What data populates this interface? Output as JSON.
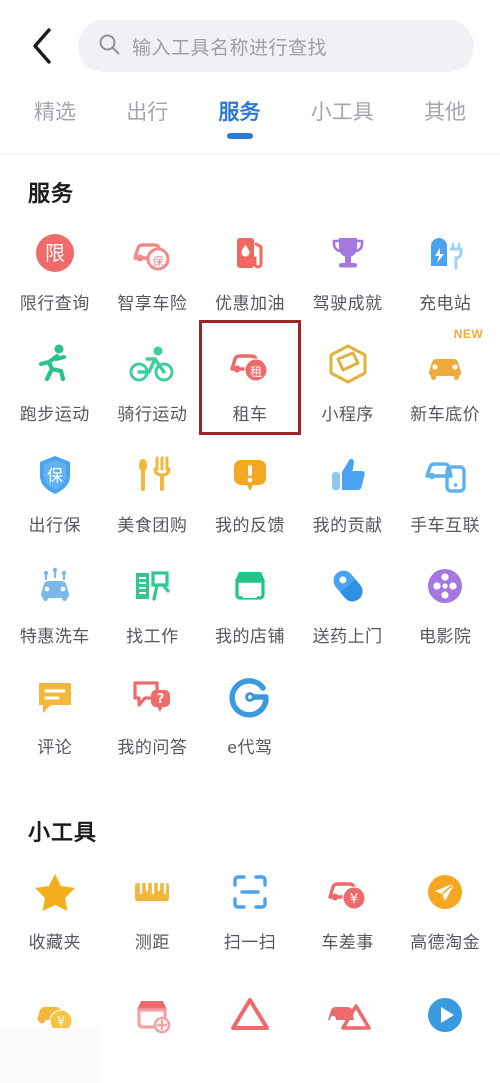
{
  "header": {
    "back_icon": "chevron-left-icon",
    "search": {
      "icon": "search-icon",
      "placeholder": "输入工具名称进行查找",
      "value": ""
    }
  },
  "tabs": {
    "active_index": 2,
    "items": [
      {
        "label": "精选"
      },
      {
        "label": "出行"
      },
      {
        "label": "服务"
      },
      {
        "label": "小工具"
      },
      {
        "label": "其他"
      }
    ]
  },
  "colors": {
    "accent": "#2f7ad4",
    "highlight_box": "#9c2528",
    "label": "#55585e",
    "tab_inactive": "#a2a6ad",
    "search_bg": "#eff1f4"
  },
  "sections": [
    {
      "title": "服务",
      "items": [
        {
          "label": "限行查询",
          "icon": "restriction-query-icon",
          "color": "#ef6b6b"
        },
        {
          "label": "智享车险",
          "icon": "car-insurance-icon",
          "color": "#f08b8b"
        },
        {
          "label": "优惠加油",
          "icon": "fuel-discount-icon",
          "color": "#f2675f"
        },
        {
          "label": "驾驶成就",
          "icon": "trophy-icon",
          "color": "#a577e0"
        },
        {
          "label": "充电站",
          "icon": "charging-station-icon",
          "color": "#4aa3f0"
        },
        {
          "label": "跑步运动",
          "icon": "running-icon",
          "color": "#29c28a"
        },
        {
          "label": "骑行运动",
          "icon": "cycling-icon",
          "color": "#3fcf9a"
        },
        {
          "label": "租车",
          "icon": "car-rental-icon",
          "color": "#ef6b6b",
          "highlighted": true
        },
        {
          "label": "小程序",
          "icon": "mini-program-icon",
          "color": "#e0b23c"
        },
        {
          "label": "新车底价",
          "icon": "new-car-price-icon",
          "color": "#f2a93b",
          "badge": "NEW"
        },
        {
          "label": "出行保",
          "icon": "travel-insurance-icon",
          "color": "#4aa3f0"
        },
        {
          "label": "美食团购",
          "icon": "food-groupon-icon",
          "color": "#f2b73b"
        },
        {
          "label": "我的反馈",
          "icon": "feedback-icon",
          "color": "#f5a623"
        },
        {
          "label": "我的贡献",
          "icon": "thumbs-up-icon",
          "color": "#4aa3f0"
        },
        {
          "label": "手车互联",
          "icon": "phone-car-link-icon",
          "color": "#5fb0ef"
        },
        {
          "label": "特惠洗车",
          "icon": "car-wash-icon",
          "color": "#7ab8e8"
        },
        {
          "label": "找工作",
          "icon": "job-search-icon",
          "color": "#2fc98d"
        },
        {
          "label": "我的店铺",
          "icon": "my-shop-icon",
          "color": "#22c48a"
        },
        {
          "label": "送药上门",
          "icon": "medicine-delivery-icon",
          "color": "#4aa3f0"
        },
        {
          "label": "电影院",
          "icon": "cinema-icon",
          "color": "#a577e0"
        },
        {
          "label": "评论",
          "icon": "comment-icon",
          "color": "#f2b73b"
        },
        {
          "label": "我的问答",
          "icon": "qa-icon",
          "color": "#ef6b6b"
        },
        {
          "label": "e代驾",
          "icon": "edaijia-icon",
          "color": "#3a9ae0"
        }
      ]
    },
    {
      "title": "小工具",
      "items": [
        {
          "label": "收藏夹",
          "icon": "star-icon",
          "color": "#f5ae1b"
        },
        {
          "label": "测距",
          "icon": "ruler-icon",
          "color": "#f2b73b"
        },
        {
          "label": "扫一扫",
          "icon": "scan-icon",
          "color": "#4aa3f0"
        },
        {
          "label": "车差事",
          "icon": "car-errand-icon",
          "color": "#ef6b6b"
        },
        {
          "label": "高德淘金",
          "icon": "gold-rush-icon",
          "color": "#f5a623"
        }
      ]
    },
    {
      "title": "",
      "clipped": true,
      "items": [
        {
          "label": "",
          "icon": "car-fee-icon",
          "color": "#f2b73b"
        },
        {
          "label": "",
          "icon": "shop-add-icon",
          "color": "#ef6b6b"
        },
        {
          "label": "",
          "icon": "warning-triangle-icon",
          "color": "#ef6b6b"
        },
        {
          "label": "",
          "icon": "car-accident-icon",
          "color": "#ef6b6b"
        },
        {
          "label": "",
          "icon": "play-circle-icon",
          "color": "#3a9ae0"
        }
      ]
    }
  ]
}
